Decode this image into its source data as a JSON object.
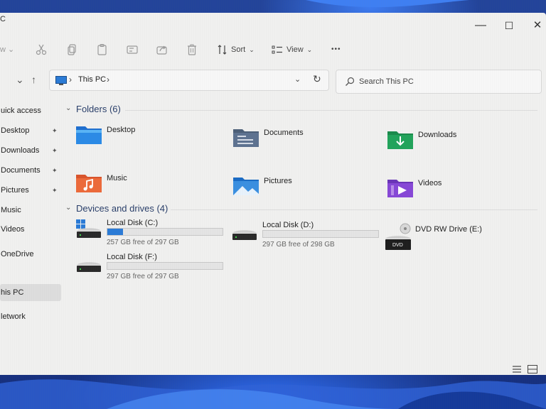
{
  "window": {
    "title_fragment": "C",
    "controls": {
      "minimize": "—",
      "maximize": "☐",
      "close": "✕"
    }
  },
  "toolbar": {
    "view_label": "w",
    "view_chevron": "⌄",
    "sort_label": "Sort",
    "sort_chevron": "⌄",
    "view2_label": "View",
    "view2_chevron": "⌄",
    "more_label": "•••"
  },
  "address": {
    "up_arrow": "↑",
    "path_label": "This PC",
    "sep_start": "›",
    "sep_end": "›",
    "dropdown": "⌄",
    "refresh": "↻"
  },
  "search": {
    "placeholder": "Search This PC"
  },
  "sidebar": {
    "items": [
      {
        "label": "uick access",
        "pinned": false
      },
      {
        "label": "Desktop",
        "pinned": true
      },
      {
        "label": "Downloads",
        "pinned": true
      },
      {
        "label": "Documents",
        "pinned": true
      },
      {
        "label": "Pictures",
        "pinned": true
      },
      {
        "label": "Music",
        "pinned": false
      },
      {
        "label": "Videos",
        "pinned": false
      },
      {
        "label": "OneDrive",
        "pinned": false
      },
      {
        "label": "his PC",
        "pinned": false,
        "active": true
      },
      {
        "label": "letwork",
        "pinned": false
      }
    ],
    "pin_glyph": "📌"
  },
  "folders": {
    "header": "Folders (6)",
    "items": [
      {
        "label": "Desktop",
        "icon": "desktop-folder-icon"
      },
      {
        "label": "Documents",
        "icon": "documents-folder-icon"
      },
      {
        "label": "Downloads",
        "icon": "downloads-folder-icon"
      },
      {
        "label": "Music",
        "icon": "music-folder-icon"
      },
      {
        "label": "Pictures",
        "icon": "pictures-folder-icon"
      },
      {
        "label": "Videos",
        "icon": "videos-folder-icon"
      }
    ]
  },
  "drives": {
    "header": "Devices and drives (4)",
    "items": [
      {
        "name": "Local Disk (C:)",
        "free": "257 GB free of 297 GB",
        "used_fraction": 0.135,
        "icon": "windows-drive-icon"
      },
      {
        "name": "Local Disk (D:)",
        "free": "297 GB free of 298 GB",
        "used_fraction": 0.0,
        "icon": "drive-icon"
      },
      {
        "name": "DVD RW Drive (E:)",
        "badge": "DVD",
        "icon": "dvd-drive-icon"
      },
      {
        "name": "Local Disk (F:)",
        "free": "297 GB free of 297 GB",
        "used_fraction": 0.0,
        "icon": "drive-icon"
      }
    ]
  },
  "colors": {
    "accent_bar": "#2b7bd6",
    "window_bg": "#f0f0ef",
    "wallpaper": "#1c3a92"
  }
}
